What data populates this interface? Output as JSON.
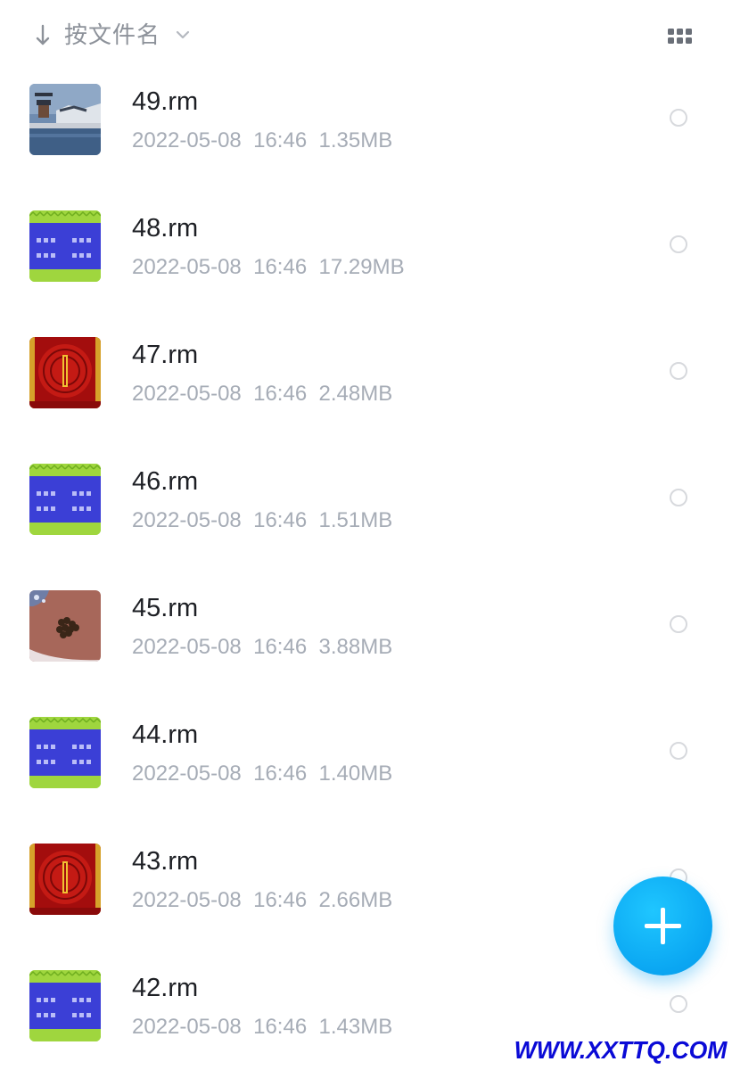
{
  "sort": {
    "label": "按文件名",
    "arrow_icon": "down-arrow-icon",
    "chevron_icon": "chevron-down-icon"
  },
  "view_toggle_icon": "grid-view-icon",
  "files": [
    {
      "name": "49.rm",
      "date": "2022-05-08",
      "time": "16:46",
      "size": "1.35MB",
      "thumb": "landscape"
    },
    {
      "name": "48.rm",
      "date": "2022-05-08",
      "time": "16:46",
      "size": "17.29MB",
      "thumb": "blue-text"
    },
    {
      "name": "47.rm",
      "date": "2022-05-08",
      "time": "16:46",
      "size": "2.48MB",
      "thumb": "red-scroll"
    },
    {
      "name": "46.rm",
      "date": "2022-05-08",
      "time": "16:46",
      "size": "1.51MB",
      "thumb": "blue-text"
    },
    {
      "name": "45.rm",
      "date": "2022-05-08",
      "time": "16:46",
      "size": "3.88MB",
      "thumb": "brown-board"
    },
    {
      "name": "44.rm",
      "date": "2022-05-08",
      "time": "16:46",
      "size": "1.40MB",
      "thumb": "blue-text"
    },
    {
      "name": "43.rm",
      "date": "2022-05-08",
      "time": "16:46",
      "size": "2.66MB",
      "thumb": "red-scroll"
    },
    {
      "name": "42.rm",
      "date": "2022-05-08",
      "time": "16:46",
      "size": "1.43MB",
      "thumb": "blue-text"
    }
  ],
  "fab": {
    "icon": "plus-icon"
  },
  "watermark": "WWW.XXTTQ.COM",
  "colors": {
    "accent": "#0aa6f2",
    "text_primary": "#1d1f24",
    "text_secondary": "#a6acb6",
    "watermark": "#0a0ad6"
  }
}
